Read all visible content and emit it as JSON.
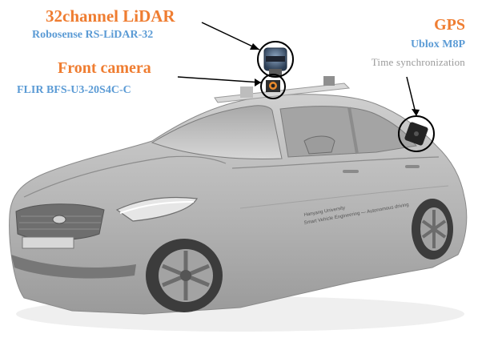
{
  "colors": {
    "title": "#ef7d31",
    "model": "#5b9bd5",
    "note": "#9a9a9a",
    "car_body": "#b9b9b9",
    "car_dark": "#6e6e6e",
    "tire": "#3c3c3c",
    "callout": "#000000"
  },
  "sensors": {
    "lidar": {
      "title": "32channel LiDAR",
      "model": "Robosense RS-LiDAR-32"
    },
    "camera": {
      "title": "Front camera",
      "model": "FLIR BFS-U3-20S4C-C"
    },
    "gps": {
      "title": "GPS",
      "model": "Ublox M8P",
      "note": "Time synchronization"
    }
  },
  "car_text": {
    "door_line1": "Hanyang University",
    "door_line2": "Smart Vehicle Engineering — Autonomous driving"
  },
  "icons": [
    "lidar-sensor-icon",
    "camera-sensor-icon",
    "gps-antenna-icon"
  ]
}
